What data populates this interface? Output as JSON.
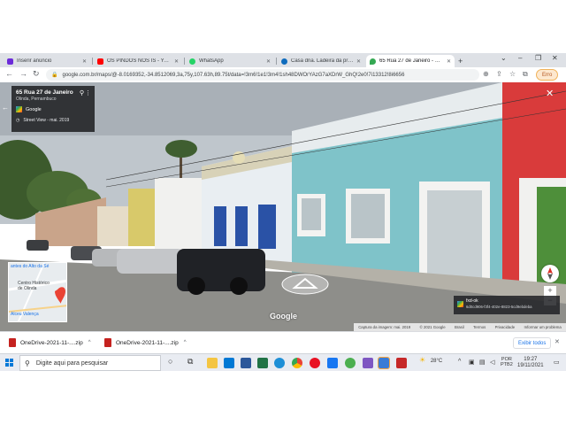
{
  "browser": {
    "tabs": [
      {
        "title": "Inserir anúncio",
        "favicon_color": "#6c2bd9",
        "active": false
      },
      {
        "title": "OS PINDOS NOS IS - YouTube",
        "favicon_color": "#ff0000",
        "active": false
      },
      {
        "title": "WhatsApp",
        "favicon_color": "#25d366",
        "active": false
      },
      {
        "title": "Casa dna. Ladeira da prefeitura",
        "favicon_color": "#0f6cbd",
        "active": false
      },
      {
        "title": "65 Rua 27 de Janeiro - Google Maps",
        "favicon_color": "#34a853",
        "active": true
      }
    ],
    "new_tab": "+",
    "address": "google.com.br/maps/@-8.0169352,-34.8512069,3a,75y,107.63h,89.75t/data=!3m6!1e1!3m4!1sh48DWOrYAzG7aXDrW_GhQ!2e0!7i13312!8i6656",
    "profile_label": "Erro"
  },
  "streetview": {
    "place_title": "65 Rua 27 de Janeiro",
    "place_subtitle": "Olinda, Pernambuco",
    "provider_label": "Google",
    "date_label": "Street View - mai. 2019",
    "minimap_labels": [
      "antes do Alto da Sé",
      "Centro Histórico de Olinda",
      "Alceu Valença"
    ],
    "thumbnail_title": "fxd-ok",
    "thumbnail_subtitle": "6d0cd906-f3f4-402e-8823-5cd9ebdeba",
    "watermark": "Google",
    "footer_items": [
      "Captura da imagem: mai. 2019",
      "© 2021 Google",
      "Brasil",
      "Termos",
      "Privacidade",
      "Informar um problema"
    ]
  },
  "downloads": {
    "items": [
      "OneDrive-2021-11-....zip",
      "OneDrive-2021-11-....zip"
    ],
    "show_all": "Exibir todos"
  },
  "taskbar": {
    "search_placeholder": "Digite aqui para pesquisar",
    "temperature": "28°C",
    "lang_line1": "POR",
    "lang_line2": "PTB2",
    "time": "19:27",
    "date": "19/11/2021"
  }
}
